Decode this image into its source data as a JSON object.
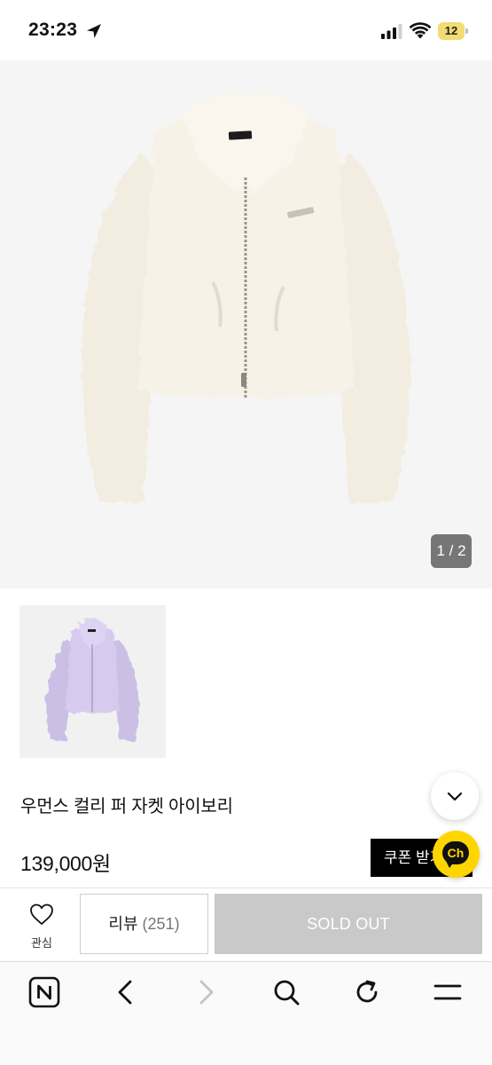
{
  "status_bar": {
    "time": "23:23",
    "battery": "12",
    "icons": [
      "location-arrow-icon",
      "signal-icon",
      "wifi-icon",
      "battery-icon"
    ]
  },
  "gallery": {
    "page_indicator": "1 / 2",
    "main_image": "ivory-fur-jacket",
    "thumbnail_image": "lavender-fur-jacket"
  },
  "product": {
    "name": "우먼스 컬리 퍼 자켓 아이보리",
    "price": "139,000원"
  },
  "floating": {
    "coupon_label": "쿠폰 받기",
    "chat_label": "Ch"
  },
  "actions": {
    "wish_label": "관심",
    "review_label": "리뷰",
    "review_count": "(251)",
    "soldout_label": "SOLD OUT"
  },
  "browser_nav": [
    "naver-home-icon",
    "back-icon",
    "forward-icon",
    "search-icon",
    "refresh-icon",
    "menu-icon"
  ],
  "colors": {
    "soldout_bg": "#c9c9c9",
    "chat_bg": "#ffd500",
    "coupon_bg": "#000000",
    "battery_bg": "#f2dc73"
  }
}
